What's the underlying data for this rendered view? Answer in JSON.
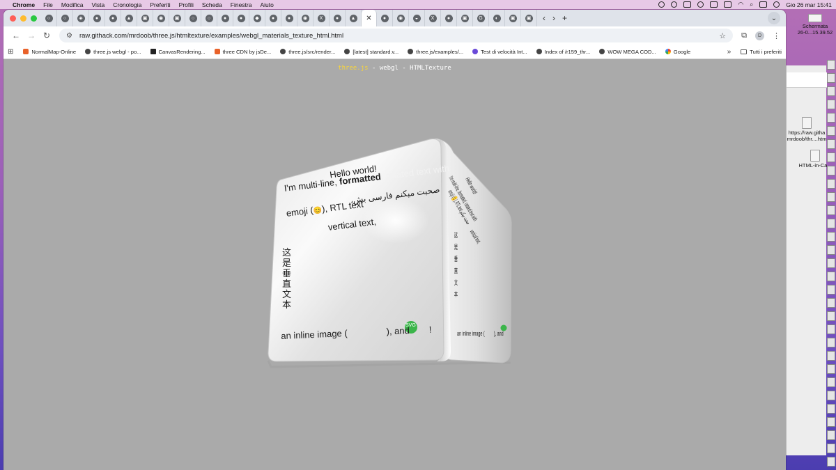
{
  "menubar": {
    "app_name": "Chrome",
    "items": [
      "File",
      "Modifica",
      "Vista",
      "Cronologia",
      "Preferiti",
      "Profili",
      "Scheda",
      "Finestra",
      "Aiuto"
    ],
    "clock": "Gio 26 mar  15:41"
  },
  "browser": {
    "url": "raw.githack.com/mrdoob/three.js/htmltexture/examples/webgl_materials_texture_html.html",
    "avatar_letter": "D",
    "tab_count": 31,
    "tab_glyphs": [
      "○",
      "○",
      "◈",
      "●",
      "●",
      "▲",
      "▣",
      "◉",
      "▣",
      "○",
      "○",
      "●",
      "●",
      "◆",
      "●",
      "●",
      "◉",
      "X",
      "●",
      "▲",
      "✕",
      "●",
      "◉",
      "◒",
      "X",
      "●",
      "▣",
      "G",
      "◐",
      "▣",
      "▣",
      "●",
      "▼",
      "●",
      "●",
      "▼",
      "G",
      "◉",
      "◐",
      "W"
    ],
    "active_tab_index": 20
  },
  "bookmarks": [
    {
      "label": "NormalMap-Online",
      "icon": "normalmap-icon"
    },
    {
      "label": "three.js webgl - po...",
      "icon": "threejs-icon"
    },
    {
      "label": "CanvasRendering...",
      "icon": "mdn-icon"
    },
    {
      "label": "three CDN by jsDe...",
      "icon": "jsdelivr-icon"
    },
    {
      "label": "three.js/src/render...",
      "icon": "github-icon"
    },
    {
      "label": "[latest] standard.v...",
      "icon": "web-icon"
    },
    {
      "label": "three.js/examples/...",
      "icon": "github-icon"
    },
    {
      "label": "Test di velocità Int...",
      "icon": "speedtest-icon"
    },
    {
      "label": "Index of /r159_thr...",
      "icon": "web-icon"
    },
    {
      "label": "WOW MEGA COD...",
      "icon": "web-icon"
    },
    {
      "label": "Google",
      "icon": "google-icon"
    }
  ],
  "bookmarks_folder": "Tutti i preferiti",
  "page": {
    "info_link": "three.js",
    "info_rest": " - webgl - HTMLTexture",
    "front": {
      "hello": "Hello world!",
      "line1_a": "I'm multi-line, ",
      "line1_b": "formatted",
      "line1_c": ", rotated text with",
      "line2_a": "emoji (",
      "line2_emoji": "😊",
      "line2_b": "), RTL text",
      "rtl": "صحبت میکنم فارسی بش،",
      "line3": "vertical text,",
      "vertical_cjk": "这是垂直文本",
      "bottom_a": "an inline image (",
      "bottom_b": "), and",
      "svg_label": "SVG",
      "bottom_c": "!"
    },
    "side": {
      "hello": "Hello world!",
      "line1": "I'm multi-line, formatted, rotated text with",
      "line2": "emoji (😊), RTL text صحبت میکنم",
      "line3": "vertical text,",
      "vertical_cjk": "这是垂直文本",
      "bottom_a": "an inline image (",
      "bottom_b": "), and"
    }
  },
  "desktop": {
    "screenshot_label_1": "Schermata",
    "screenshot_label_2": "26-0...15.39.52",
    "file_label_1": "https://raw.githa",
    "file_label_2": "mrdoob/thr....htm",
    "file_label_3": "HTML-in-Ca..."
  }
}
